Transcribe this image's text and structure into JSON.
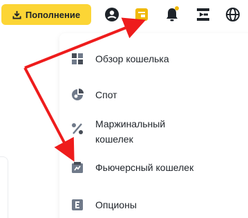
{
  "header": {
    "deposit_label": "Пополнение",
    "icons": [
      "download-icon",
      "profile-icon",
      "wallet-icon",
      "notifications-icon",
      "transfer-icon",
      "globe-icon"
    ],
    "accent_color": "#fcd535",
    "notification_dot_color": "#f0b90b"
  },
  "wallet_menu": {
    "items": [
      {
        "label": "Обзор кошелька",
        "icon": "overview-icon"
      },
      {
        "label": "Спот",
        "icon": "spot-icon"
      },
      {
        "label": "Маржинальный кошелек",
        "icon": "margin-icon"
      },
      {
        "label": "Фьючерсный кошелек",
        "icon": "futures-icon"
      },
      {
        "label": "Опционы",
        "icon": "options-icon"
      }
    ]
  },
  "annotation": {
    "arrow_color": "#ee1c1c"
  }
}
